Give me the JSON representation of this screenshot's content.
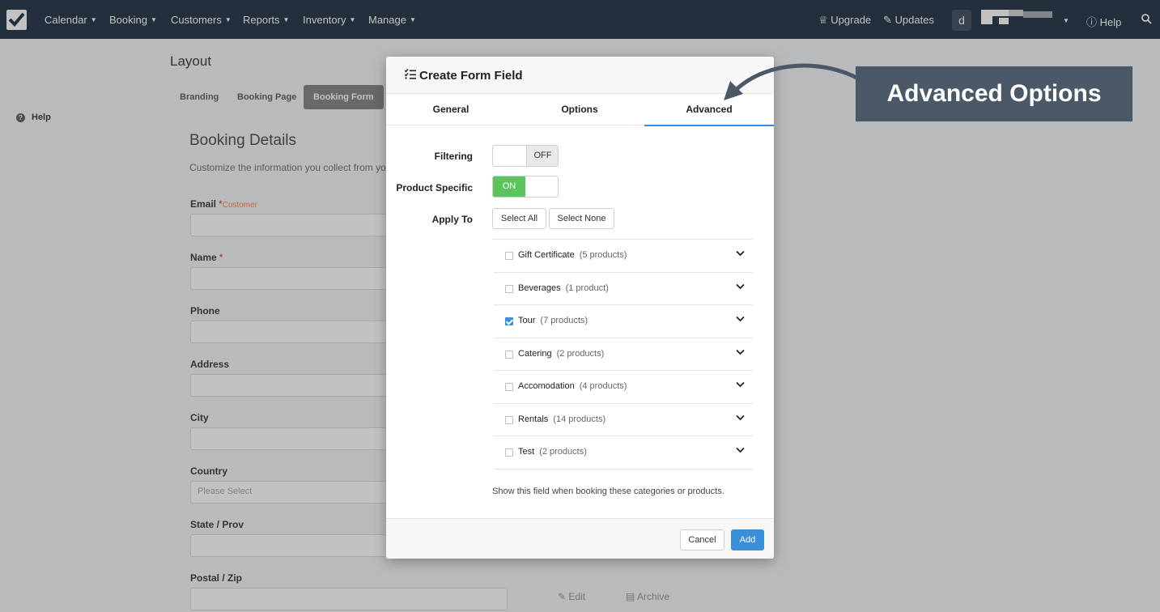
{
  "nav": {
    "items": [
      "Calendar",
      "Booking",
      "Customers",
      "Reports",
      "Inventory",
      "Manage"
    ],
    "upgrade": "Upgrade",
    "updates": "Updates",
    "avatar_letter": "d",
    "help": "Help"
  },
  "sidebar": {
    "help": "Help"
  },
  "page": {
    "title": "Layout",
    "tabs": [
      "Branding",
      "Booking Page",
      "Booking Form"
    ],
    "section_title": "Booking Details",
    "section_desc": "Customize the information you collect from you",
    "fields": {
      "email": "Email",
      "email_sub": "Customer",
      "name": "Name",
      "phone": "Phone",
      "address": "Address",
      "city": "City",
      "country": "Country",
      "country_placeholder": "Please Select",
      "state": "State / Prov",
      "postal": "Postal / Zip",
      "required_mark": "*"
    },
    "actions": {
      "edit": "Edit",
      "archive": "Archive"
    }
  },
  "modal": {
    "title": "Create Form Field",
    "tabs": [
      "General",
      "Options",
      "Advanced"
    ],
    "active_tab": "Advanced",
    "filtering": {
      "label": "Filtering",
      "state": "OFF"
    },
    "product_specific": {
      "label": "Product Specific",
      "state": "ON"
    },
    "apply_to": {
      "label": "Apply To",
      "select_all": "Select All",
      "select_none": "Select None"
    },
    "categories": [
      {
        "name": "Gift Certificate",
        "count": "(5 products)",
        "checked": false
      },
      {
        "name": "Beverages",
        "count": "(1 product)",
        "checked": false
      },
      {
        "name": "Tour",
        "count": "(7 products)",
        "checked": true
      },
      {
        "name": "Catering",
        "count": "(2 products)",
        "checked": false
      },
      {
        "name": "Accomodation",
        "count": "(4 products)",
        "checked": false
      },
      {
        "name": "Rentals",
        "count": "(14 products)",
        "checked": false
      },
      {
        "name": "Test",
        "count": "(2 products)",
        "checked": false
      }
    ],
    "hint": "Show this field when booking these categories or products.",
    "cancel": "Cancel",
    "add": "Add"
  },
  "callout": "Advanced Options",
  "colors": {
    "nav_bg": "#2f3e50",
    "accent": "#3b8fd9",
    "toggle_on": "#5cc45c",
    "callout_bg": "#4a5868"
  }
}
